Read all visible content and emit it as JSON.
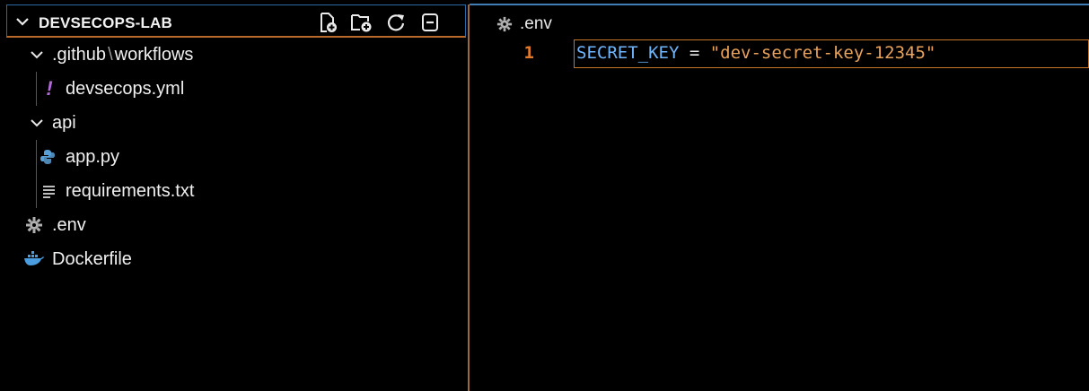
{
  "explorer": {
    "title": "DEVSECOPS-LAB",
    "actions": [
      {
        "name": "new-file-icon"
      },
      {
        "name": "new-folder-icon"
      },
      {
        "name": "refresh-icon"
      },
      {
        "name": "collapse-all-icon"
      }
    ],
    "tree": {
      "github_folder": ".github",
      "github_sep": "\\",
      "github_subfolder": "workflows",
      "devsecops_file": "devsecops.yml",
      "api_folder": "api",
      "app_file": "app.py",
      "requirements_file": "requirements.txt",
      "env_file": ".env",
      "dockerfile": "Dockerfile"
    }
  },
  "editor": {
    "tab_label": ".env",
    "line_number": "1",
    "code_key": "SECRET_KEY",
    "code_op": " = ",
    "code_value": "\"dev-secret-key-12345\""
  },
  "colors": {
    "accent_blue": "#3f7fb5",
    "focus_orange": "#c8752a",
    "line_number": "#e07a2a",
    "string": "#e9a35a",
    "key": "#6fb6ff"
  }
}
